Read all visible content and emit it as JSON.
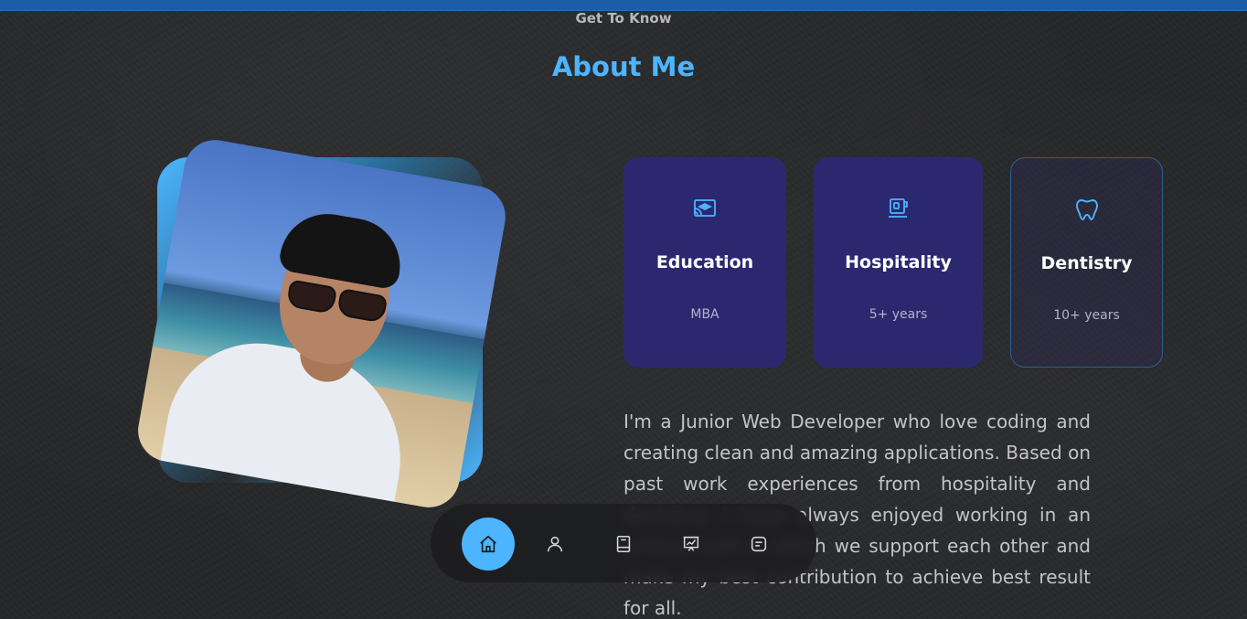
{
  "header": {
    "subtitle": "Get To Know",
    "title": "About Me"
  },
  "photo": {
    "alt": "profile photo at the beach"
  },
  "cards": [
    {
      "icon": "education-icon",
      "title": "Education",
      "sub": "MBA"
    },
    {
      "icon": "hospitality-icon",
      "title": "Hospitality",
      "sub": "5+ years"
    },
    {
      "icon": "tooth-icon",
      "title": "Dentistry",
      "sub": "10+ years"
    }
  ],
  "about_text": "I'm a Junior Web Developer who love coding and creating clean and amazing applications. Based on past work experiences from hospitality and dentistry, I have always enjoyed working in an environment in which we support each other and make my best contribution to achieve best result for all.",
  "nav": {
    "items": [
      {
        "icon": "home-icon",
        "active": true
      },
      {
        "icon": "user-icon",
        "active": false
      },
      {
        "icon": "book-icon",
        "active": false
      },
      {
        "icon": "presentation-icon",
        "active": false
      },
      {
        "icon": "message-icon",
        "active": false
      }
    ]
  },
  "colors": {
    "accent": "#4db5ff",
    "card_bg": "#2c2870",
    "background": "#262729",
    "topbar": "#1b5ea7"
  }
}
